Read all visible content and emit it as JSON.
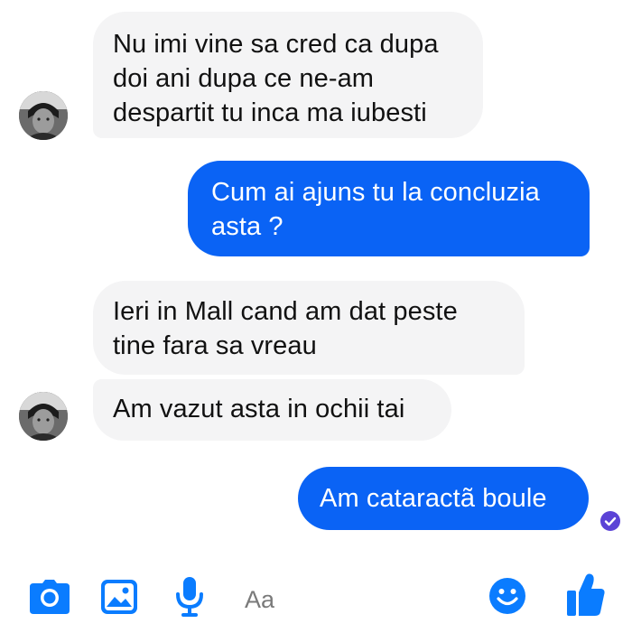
{
  "conversation": {
    "messages": [
      {
        "sender": "contact",
        "text": "Nu imi vine sa cred ca dupa\ndoi ani dupa ce ne-am\ndespartit tu inca ma iubesti"
      },
      {
        "sender": "me",
        "text": "Cum ai ajuns tu la concluzia\nasta ?"
      },
      {
        "sender": "contact",
        "text": "Ieri in Mall cand am dat peste\ntine fara sa vreau"
      },
      {
        "sender": "contact",
        "text": "Am vazut asta in ochii tai"
      },
      {
        "sender": "me",
        "text": "Am cataractã boule"
      }
    ],
    "read_receipt": "check-icon"
  },
  "composer": {
    "placeholder": "Aa",
    "icons": [
      "camera-icon",
      "image-icon",
      "microphone-icon",
      "emoji-icon",
      "thumbs-up-icon"
    ]
  },
  "colors": {
    "outgoing_bubble": "#0a63f5",
    "incoming_bubble": "#f4f4f5",
    "accent": "#0a7cff",
    "seen_badge": "#5b43d6"
  }
}
